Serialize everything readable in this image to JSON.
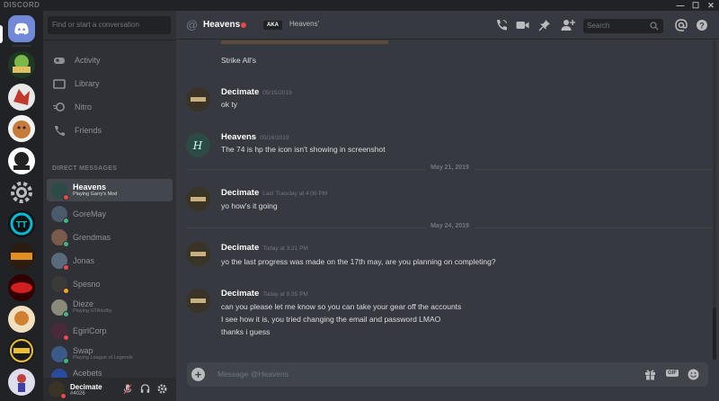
{
  "app": {
    "brand": "DISCORD"
  },
  "window_controls": {
    "minimize": "—",
    "maximize": "☐",
    "close": "✕"
  },
  "sidebar": {
    "search_placeholder": "Find or start a conversation",
    "nav": [
      {
        "label": "Activity",
        "icon": "gamepad-icon"
      },
      {
        "label": "Library",
        "icon": "library-icon"
      },
      {
        "label": "Nitro",
        "icon": "nitro-icon"
      },
      {
        "label": "Friends",
        "icon": "friends-icon"
      }
    ],
    "dm_heading": "DIRECT MESSAGES",
    "dms": [
      {
        "name": "Heavens",
        "status_text": "Playing Garry's Mod",
        "status": "dnd",
        "color": "#2c4a46"
      },
      {
        "name": "GoreMay",
        "status_text": "",
        "status": "online",
        "color": "#4a5a6a"
      },
      {
        "name": "Grendmas",
        "status_text": "",
        "status": "online",
        "color": "#7a5a4a"
      },
      {
        "name": "Jonas",
        "status_text": "",
        "status": "dnd",
        "color": "#5a6a7a"
      },
      {
        "name": "Spesno",
        "status_text": "",
        "status": "idle",
        "color": "#3a3a3a"
      },
      {
        "name": "Dieze",
        "status_text": "Playing GTAlodby",
        "status": "online",
        "color": "#8a8a7a"
      },
      {
        "name": "EgirlCorp",
        "status_text": "",
        "status": "dnd",
        "color": "#4a2a3a"
      },
      {
        "name": "Swap",
        "status_text": "Playing League of Legends",
        "status": "online",
        "color": "#3a5a8a"
      },
      {
        "name": "Acebets",
        "status_text": "",
        "status": "online",
        "color": "#2a4a9a"
      }
    ],
    "user": {
      "name": "Decimate",
      "tag": "#4026"
    }
  },
  "header": {
    "channel_name": "Heavens",
    "aka_label": "AKA",
    "aka_name": "Heavens'",
    "search_placeholder": "Search"
  },
  "messages": {
    "top_line": "Strike All's",
    "groups": [
      {
        "author": "Decimate",
        "timestamp": "05/15/2019",
        "lines": [
          "ok ty"
        ]
      },
      {
        "author": "Heavens",
        "timestamp": "05/16/2019",
        "lines": [
          "The 74 is hp the icon isn't showing in screenshot"
        ]
      },
      {
        "author": "Decimate",
        "timestamp": "Last Tuesday at 4:06 PM",
        "lines": [
          "yo how's it going"
        ]
      },
      {
        "author": "Decimate",
        "timestamp": "Today at 3:21 PM",
        "lines": [
          "yo the last progress was made on the 17th may, are you planning on completing?"
        ]
      },
      {
        "author": "Decimate",
        "timestamp": "Today at 8:35 PM",
        "lines": [
          "can you please let me know so you can take your gear off the accounts",
          "I see how it is, you tried changing the email and password LMAO",
          "thanks i guess"
        ]
      }
    ],
    "dividers": [
      "May 21, 2019",
      "May 24, 2019"
    ]
  },
  "composer": {
    "placeholder": "Message @Heavens",
    "gif_label": "GIF"
  },
  "colors": {
    "blurple": "#7289da",
    "online": "#43b581",
    "idle": "#faa61a",
    "dnd": "#f04747"
  }
}
